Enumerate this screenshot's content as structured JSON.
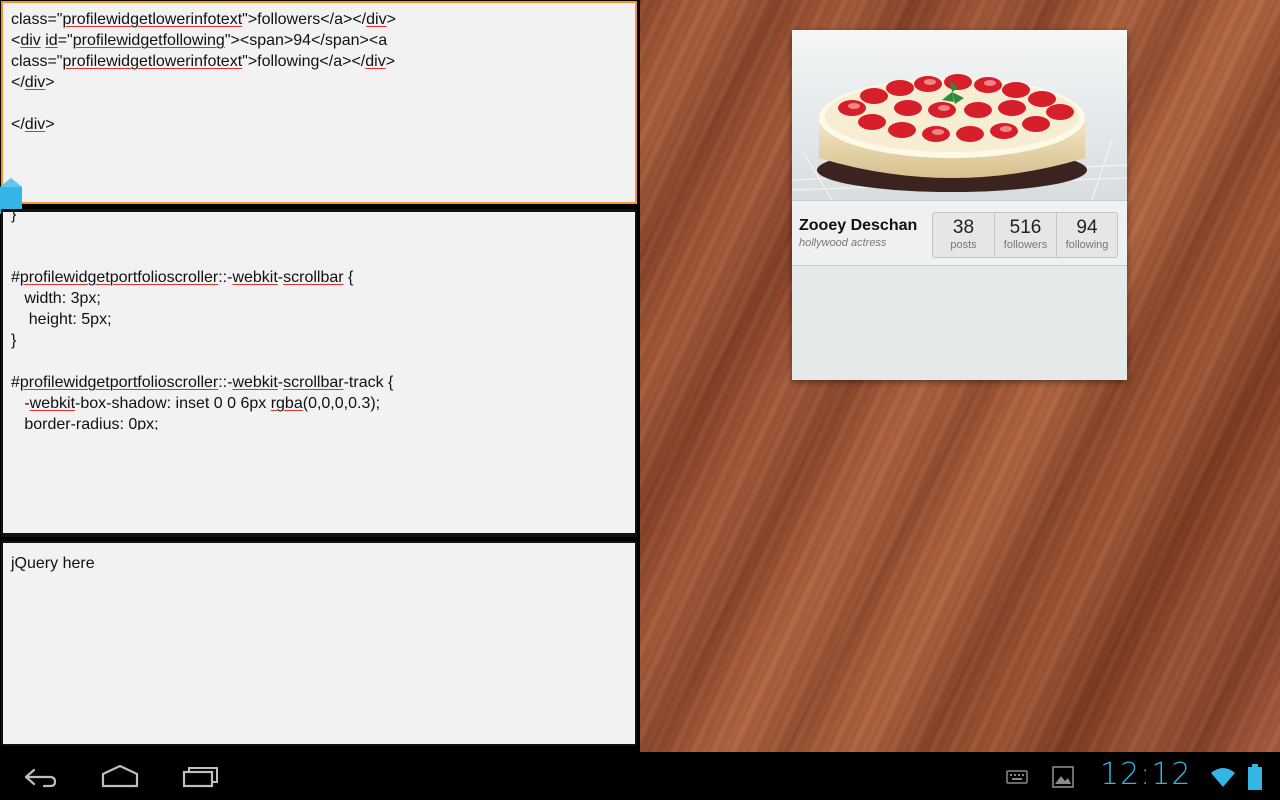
{
  "html_editor": {
    "lines": [
      [
        {
          "t": "class=\""
        },
        {
          "t": "profilewidgetlowerinfotext",
          "sp": true
        },
        {
          "t": "\">followers</a></"
        },
        {
          "t": "div",
          "sp": true
        },
        {
          "t": ">"
        }
      ],
      [
        {
          "t": "<"
        },
        {
          "t": "div",
          "sp": true
        },
        {
          "t": " "
        },
        {
          "t": "id",
          "sp": true
        },
        {
          "t": "=\""
        },
        {
          "t": "profilewidgetfollowing",
          "sp": true
        },
        {
          "t": "\"><span>94</span><a"
        }
      ],
      [
        {
          "t": "class=\""
        },
        {
          "t": "profilewidgetlowerinfotext",
          "sp": true
        },
        {
          "t": "\">following</a></"
        },
        {
          "t": "div",
          "sp": true
        },
        {
          "t": ">"
        }
      ],
      [
        {
          "t": "</"
        },
        {
          "t": "div",
          "sp": true
        },
        {
          "t": ">"
        }
      ],
      [
        {
          "t": ""
        }
      ],
      [
        {
          "t": "</"
        },
        {
          "t": "div",
          "sp": true
        },
        {
          "t": ">"
        }
      ]
    ]
  },
  "css_editor": {
    "lines": [
      [
        {
          "t": "}"
        }
      ],
      [
        {
          "t": ""
        }
      ],
      [
        {
          "t": ""
        }
      ],
      [
        {
          "t": "#"
        },
        {
          "t": "profilewidgetportfolioscroller",
          "sp": true
        },
        {
          "t": "::-"
        },
        {
          "t": "webkit",
          "sp": true
        },
        {
          "t": "-"
        },
        {
          "t": "scrollbar",
          "sp": true
        },
        {
          "t": " {"
        }
      ],
      [
        {
          "t": "   width: 3px;"
        }
      ],
      [
        {
          "t": "    height: 5px;"
        }
      ],
      [
        {
          "t": "}"
        }
      ],
      [
        {
          "t": ""
        }
      ],
      [
        {
          "t": "#"
        },
        {
          "t": "profilewidgetportfolioscroller",
          "sp": true
        },
        {
          "t": "::-"
        },
        {
          "t": "webkit",
          "sp": true
        },
        {
          "t": "-"
        },
        {
          "t": "scrollbar",
          "sp": true
        },
        {
          "t": "-track {"
        }
      ],
      [
        {
          "t": "   -"
        },
        {
          "t": "webkit",
          "sp": true
        },
        {
          "t": "-box-shadow: inset 0 0 6px "
        },
        {
          "t": "rgba",
          "sp": true
        },
        {
          "t": "(0,0,0,0.3);"
        }
      ],
      [
        {
          "t": "   border-radius: 0px;"
        }
      ]
    ]
  },
  "js_editor": {
    "text": "jQuery here"
  },
  "profile": {
    "name": "Zooey Deschan",
    "subtitle": "hollywood actress",
    "stats": [
      {
        "value": "38",
        "label": "posts"
      },
      {
        "value": "516",
        "label": "followers"
      },
      {
        "value": "94",
        "label": "following"
      }
    ]
  },
  "system_bar": {
    "clock": "12:12",
    "accent": "#33b5e5"
  },
  "colors": {
    "active_editor_border": "#f7942d",
    "spell_underline": "#e03030"
  }
}
